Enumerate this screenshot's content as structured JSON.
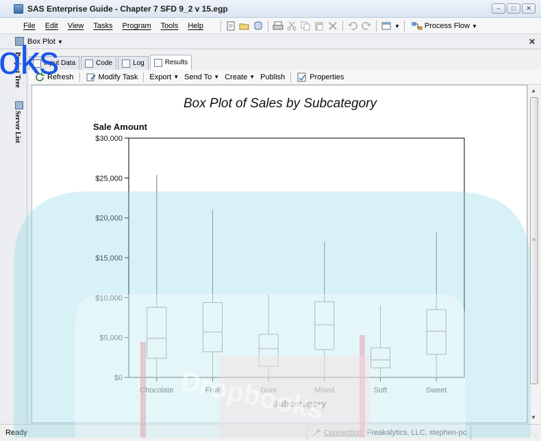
{
  "window": {
    "title": "SAS Enterprise Guide - Chapter 7 SFD 9_2 v 15.egp",
    "minimize_icon": "minimize-icon",
    "maximize_icon": "maximize-icon",
    "close_icon": "close-icon"
  },
  "menubar": {
    "items": [
      "File",
      "Edit",
      "View",
      "Tasks",
      "Program",
      "Tools",
      "Help"
    ],
    "process_flow_label": "Process Flow"
  },
  "doc_tab": {
    "title": "Box Plot"
  },
  "left_panel": {
    "project_tree": "Project Tree",
    "server_list": "Server List"
  },
  "result_tabs": [
    "Input Data",
    "Code",
    "Log",
    "Results"
  ],
  "results_toolbar": {
    "refresh": "Refresh",
    "modify_task": "Modify Task",
    "export": "Export",
    "send_to": "Send To",
    "create": "Create",
    "publish": "Publish",
    "properties": "Properties"
  },
  "status": {
    "ready": "Ready",
    "connection_label": "Connection:",
    "connection_value": "Freakalytics, LLC, stephen-pc"
  },
  "watermark": {
    "text": "oks",
    "brand": "Dropbooks"
  },
  "colors": {
    "accent": "#1a55e8",
    "watermark_teal": "#8fd6e6",
    "watermark_pink": "#e2a8b3"
  },
  "chart_data": {
    "type": "boxplot",
    "title": "Box Plot of Sales by Subcategory",
    "ylabel": "Sale Amount",
    "xlabel": "Subcategory",
    "ylim": [
      0,
      30000
    ],
    "yticks": [
      "$0",
      "$5,000",
      "$10,000",
      "$15,000",
      "$20,000",
      "$25,000",
      "$30,000"
    ],
    "categories": [
      "Chocolate",
      "Fruit",
      "Gum",
      "Mixed",
      "Soft",
      "Sweet"
    ],
    "boxes": [
      {
        "min": 0,
        "q1": 2400,
        "median": 4900,
        "q3": 8800,
        "max": 25400
      },
      {
        "min": 0,
        "q1": 3200,
        "median": 5700,
        "q3": 9400,
        "max": 21000
      },
      {
        "min": 0,
        "q1": 1400,
        "median": 3600,
        "q3": 5400,
        "max": 10400
      },
      {
        "min": 0,
        "q1": 3500,
        "median": 6600,
        "q3": 9500,
        "max": 17000
      },
      {
        "min": 0,
        "q1": 1200,
        "median": 2200,
        "q3": 3700,
        "max": 9000
      },
      {
        "min": 0,
        "q1": 2900,
        "median": 5800,
        "q3": 8500,
        "max": 18200
      }
    ]
  }
}
